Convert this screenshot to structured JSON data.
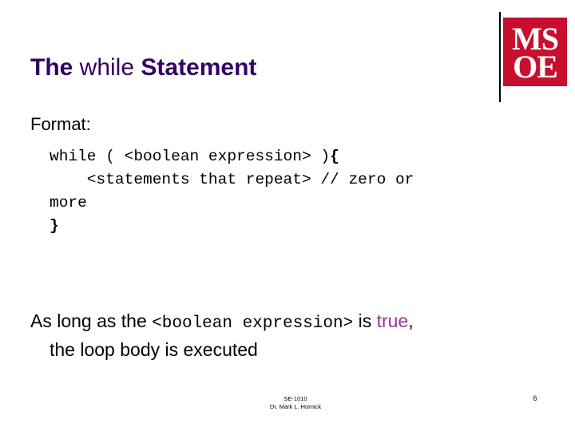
{
  "slide": {
    "background_color": "#ffffff",
    "title": {
      "part1": "The ",
      "keyword": "while",
      "part2": " Statement",
      "color": "#330066"
    },
    "logo": {
      "name": "MSOE",
      "line1": "MS",
      "line2": "OE",
      "background_color": "#c8102e",
      "text_color": "#ffffff"
    },
    "format_label": "Format:",
    "code_block": {
      "line1_a": "while ( <boolean expression> )",
      "line1_brace": "{",
      "line2": "    <statements that repeat> // zero or",
      "line3": "more",
      "line4_brace": "}"
    },
    "body": {
      "line1_a": "As long as the ",
      "line1_mono": "<boolean expression>",
      "line1_b": " is ",
      "line1_true": "true",
      "line1_c": ",",
      "line2": "the loop body is executed",
      "true_color": "#993399"
    },
    "footer": {
      "course": "SE-1010",
      "author": "Dr. Mark L. Hornick",
      "page_number": "6"
    }
  }
}
